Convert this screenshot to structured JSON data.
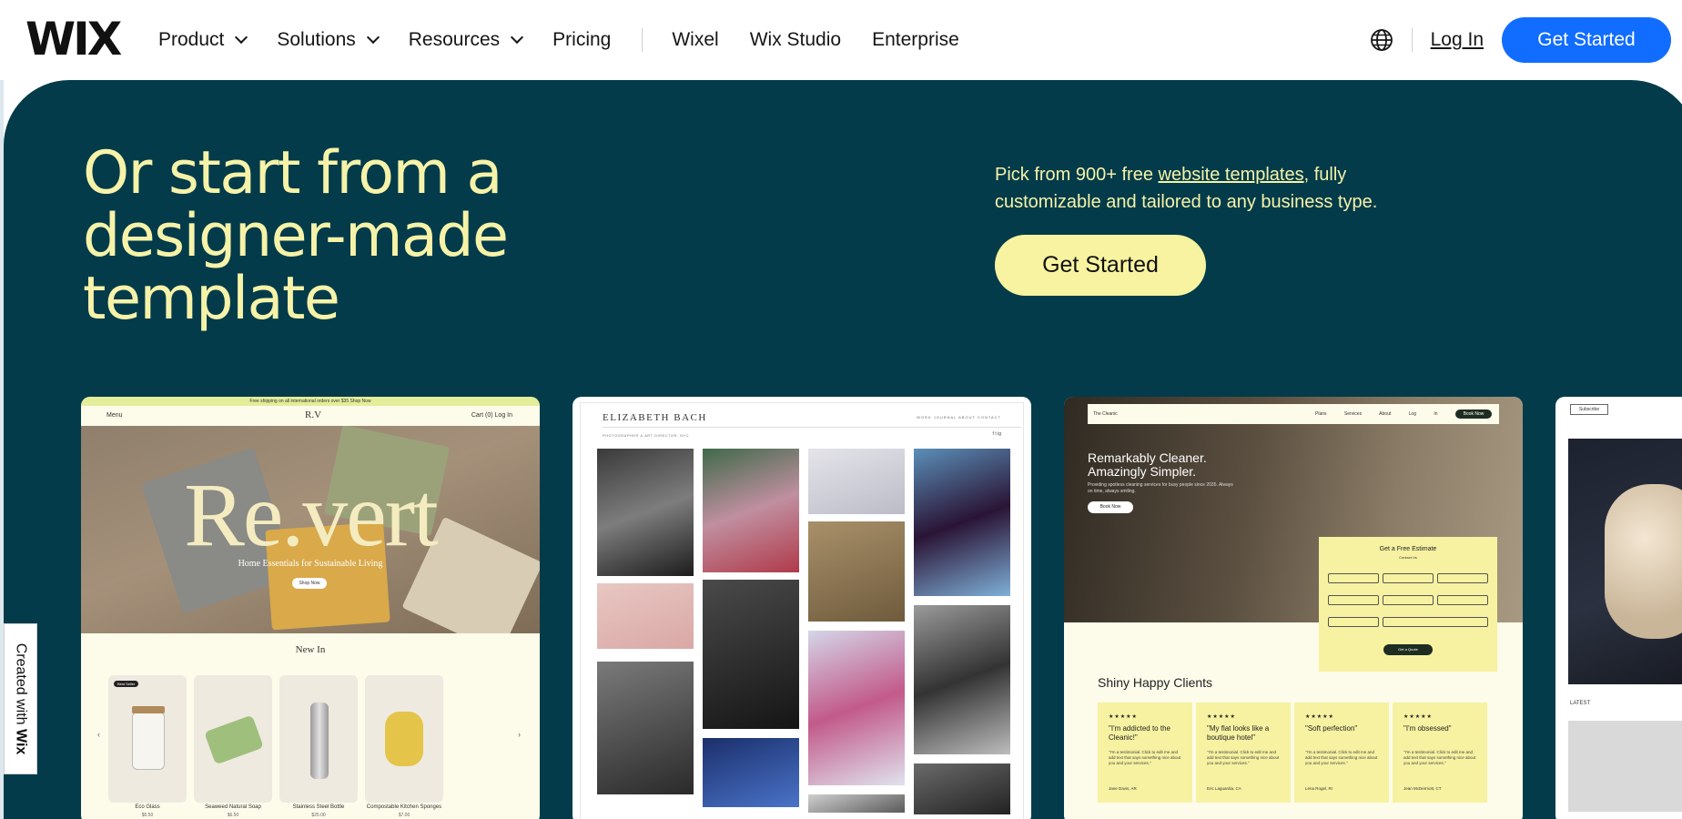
{
  "header": {
    "logo": "WIX",
    "nav": [
      {
        "label": "Product",
        "dropdown": true
      },
      {
        "label": "Solutions",
        "dropdown": true
      },
      {
        "label": "Resources",
        "dropdown": true
      },
      {
        "label": "Pricing",
        "dropdown": false
      }
    ],
    "nav_secondary": [
      "Wixel",
      "Wix Studio",
      "Enterprise"
    ],
    "login": "Log In",
    "cta": "Get Started",
    "cta_color": "#116dff"
  },
  "hero": {
    "title": "Or start from a designer-made template",
    "subtitle_before": "Pick from 900+ free ",
    "subtitle_link": "website templates",
    "subtitle_after": ", fully customizable and tailored to any business type.",
    "cta": "Get Started",
    "bg_color": "#033b4a",
    "accent_color": "#f6f3a9"
  },
  "templates": {
    "revert": {
      "banner": "Free shipping on all international orders over $35 Shop Now",
      "menu": "Menu",
      "logo": "R.V",
      "header_right": "Cart (0)   Log In",
      "title": "Re.vert",
      "tagline": "Home Essentials for Sustainable Living",
      "shop_button": "Shop Now",
      "section_title": "New In",
      "badge": "Best Seller",
      "products": [
        {
          "name": "Eco Glass",
          "price": "$5.50"
        },
        {
          "name": "Seaweed Natural Soap",
          "price": "$6.50"
        },
        {
          "name": "Stainless Steel Bottle",
          "price": "$25.00"
        },
        {
          "name": "Compostable Kitchen Sponges",
          "price": "$7.00"
        }
      ]
    },
    "elizabeth": {
      "name": "ELIZABETH BACH",
      "menu": "WORK   JOURNAL   ABOUT   CONTACT",
      "subtitle": "PHOTOGRAPHER & ART DIRECTOR, NYC",
      "social": "f  t  ig"
    },
    "cleaning": {
      "brand": "The Cleanic",
      "links": "Plans Services About Log In",
      "book": "Book Now",
      "headline_1": "Remarkably Cleaner.",
      "headline_2": "Amazingly Simpler.",
      "description": "Providing spotless cleaning services for busy people since 2035. Always on time, always smiling.",
      "button": "Book Now",
      "form_title": "Get a Free Estimate",
      "form_subtitle": "Contact Us",
      "form_button": "Get a Quote",
      "clients_title": "Shiny Happy Clients",
      "reviews": [
        {
          "stars": "★★★★★",
          "quote": "\"I'm addicted to the Cleanic!\"",
          "text": "\"I'm a testimonial. Click to edit me and add text that says something nice about you and your services.\"",
          "author": "Jane Davis, AR"
        },
        {
          "stars": "★★★★★",
          "quote": "\"My flat looks like a boutique hotel\"",
          "text": "\"I'm a testimonial. Click to edit me and add text that says something nice about you and your services.\"",
          "author": "Eric Laguardia, CA"
        },
        {
          "stars": "★★★★★",
          "quote": "\"Soft perfection\"",
          "text": "\"I'm a testimonial. Click to edit me and add text that says something nice about you and your services.\"",
          "author": "Lena Rogel, RI"
        },
        {
          "stars": "★★★★★",
          "quote": "\"I'm obsessed\"",
          "text": "\"I'm a testimonial. Click to edit me and add text that says something nice about you and your services.\"",
          "author": "Jean McDermott, CT"
        }
      ]
    },
    "fourth": {
      "subscribe": "Subscribe",
      "latest": "LATEST"
    }
  },
  "badge": {
    "prefix": "Created with ",
    "brand": "Wix"
  }
}
